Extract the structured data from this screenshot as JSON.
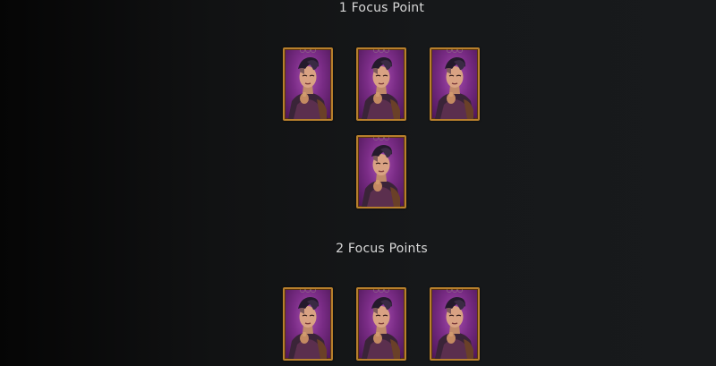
{
  "sections": [
    {
      "title": "1 Focus Point"
    },
    {
      "title": "2 Focus Points"
    }
  ],
  "card": {
    "stars": "○○○",
    "border_color": "#b77f2c",
    "background_color": "#8a3596",
    "icon": "champion-portrait-icon"
  }
}
